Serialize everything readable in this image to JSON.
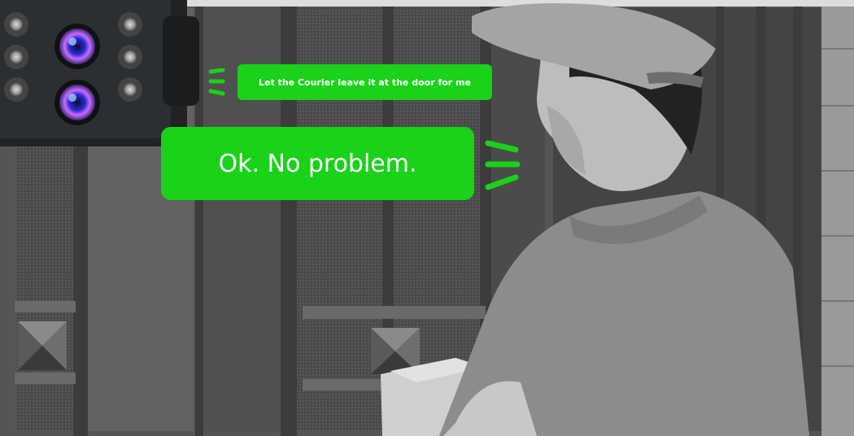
{
  "speech": {
    "owner_message": "Let the Courier leave it at the door for me",
    "courier_reply": "Ok. No problem."
  },
  "colors": {
    "bubble_green": "#19d219",
    "camera_lens_glow": "#8f7bff"
  },
  "icons": [
    "doorbell-camera-icon",
    "sound-wave-icon"
  ]
}
